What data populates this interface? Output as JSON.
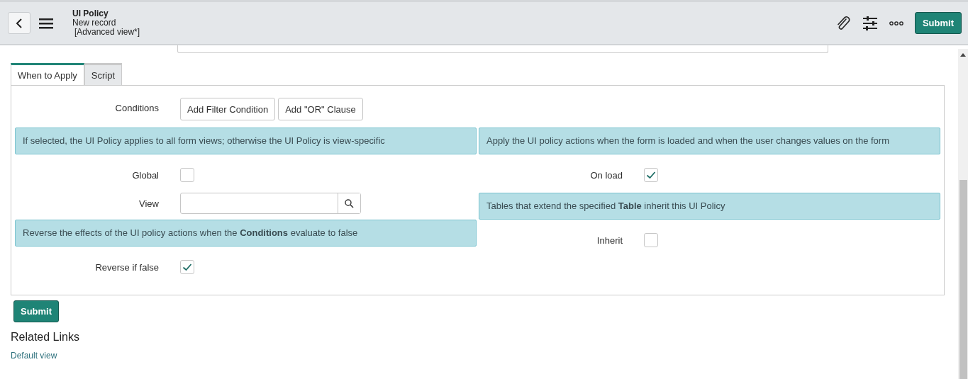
{
  "header": {
    "title": "UI Policy",
    "subtitle": "New record",
    "view": "[Advanced view*]",
    "submit": "Submit"
  },
  "tabs": [
    {
      "label": "When to Apply",
      "selected": true
    },
    {
      "label": "Script",
      "selected": false
    }
  ],
  "conditions": {
    "label": "Conditions",
    "buttons": [
      "Add Filter Condition",
      "Add \"OR\" Clause"
    ]
  },
  "left_column": [
    {
      "kind": "info",
      "text": "If selected, the UI Policy applies to all form views; otherwise the UI Policy is view-specific"
    },
    {
      "kind": "checkbox",
      "label": "Global",
      "checked": false
    },
    {
      "kind": "lookup",
      "label": "View"
    },
    {
      "kind": "info",
      "text": "Reverse the effects of the UI policy actions when the **Conditions** evaluate to false"
    },
    {
      "kind": "checkbox",
      "label": "Reverse if false",
      "checked": true
    }
  ],
  "right_column": [
    {
      "kind": "info",
      "text": "Apply the UI policy actions when the form is loaded and when the user changes values on the form"
    },
    {
      "kind": "checkbox",
      "label": "On load",
      "checked": true
    },
    {
      "kind": "info",
      "text": "Tables that extend the specified **Table** inherit this UI Policy"
    },
    {
      "kind": "checkbox",
      "label": "Inherit",
      "checked": false
    }
  ],
  "submit": "Submit",
  "related_links": {
    "title": "Related Links",
    "links": [
      "Default view"
    ]
  }
}
